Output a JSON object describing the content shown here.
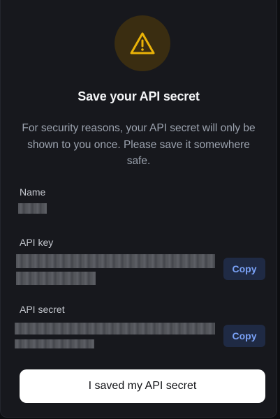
{
  "dialog": {
    "title": "Save your API secret",
    "description": "For security reasons, your API secret will only be shown to you once. Please save it somewhere safe.",
    "icon": "warning-icon",
    "accent_color": "#eab308"
  },
  "fields": {
    "name": {
      "label": "Name"
    },
    "api_key": {
      "label": "API key",
      "copy_label": "Copy"
    },
    "api_secret": {
      "label": "API secret",
      "copy_label": "Copy"
    }
  },
  "actions": {
    "confirm_label": "I saved my API secret"
  }
}
